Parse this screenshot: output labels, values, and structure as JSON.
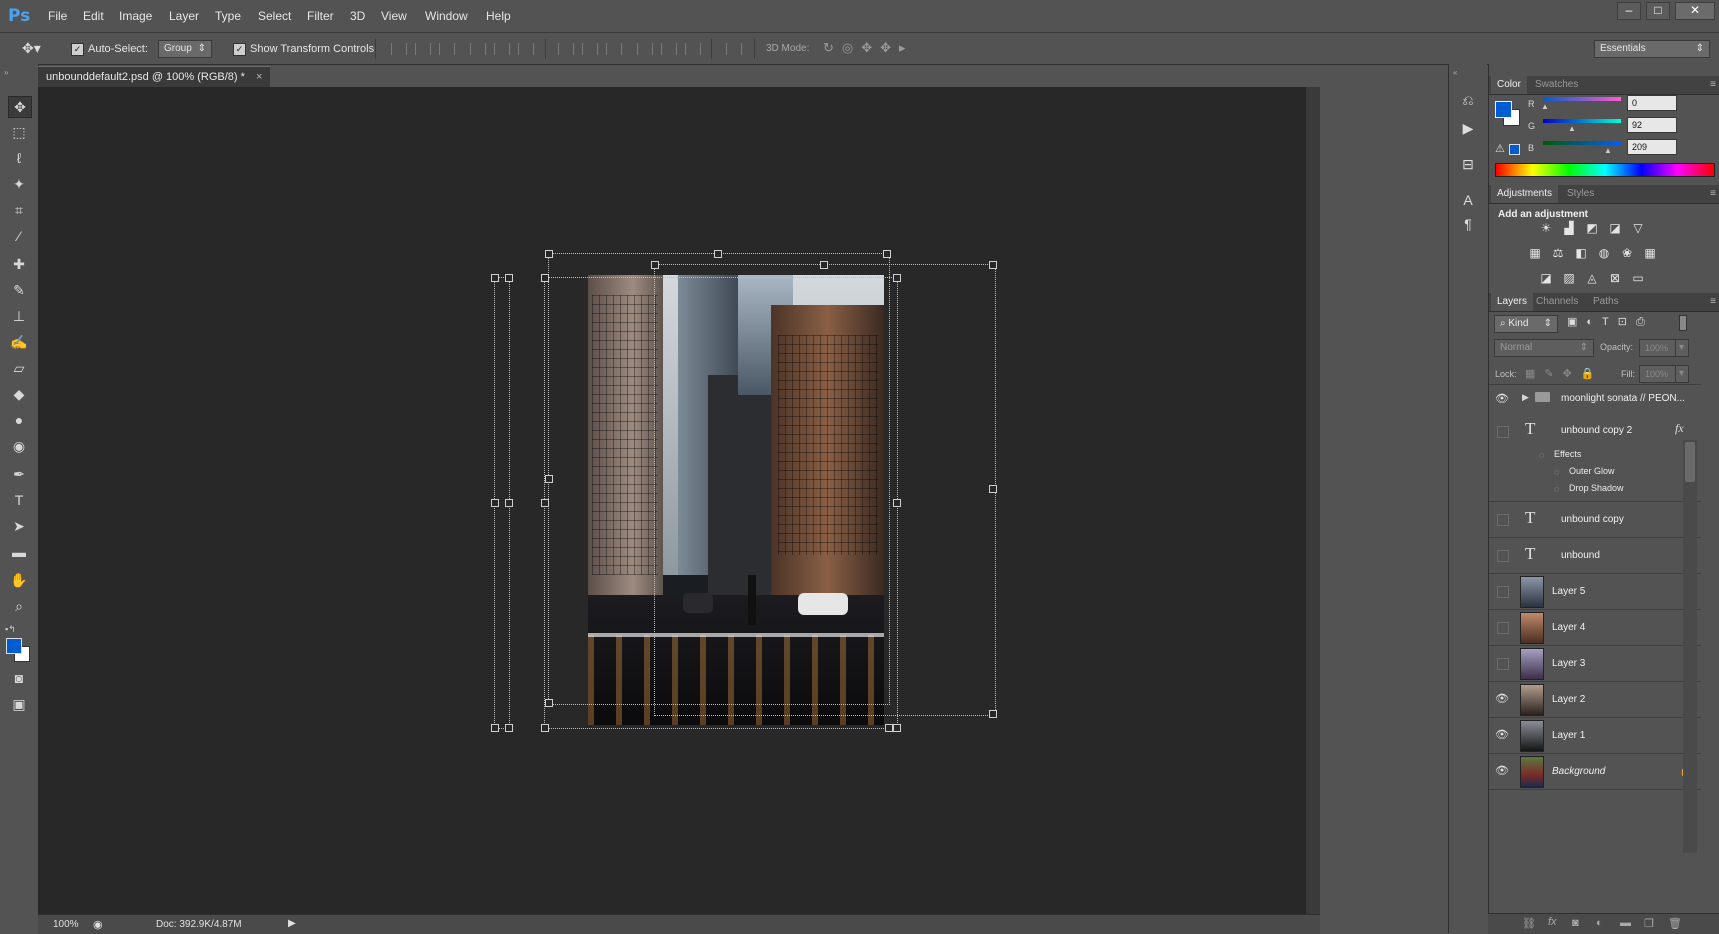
{
  "app": {
    "logo": "Ps",
    "menus": [
      "File",
      "Edit",
      "Image",
      "Layer",
      "Type",
      "Select",
      "Filter",
      "3D",
      "View",
      "Window",
      "Help"
    ],
    "window_buttons": [
      "–",
      "□",
      "✕"
    ]
  },
  "options_bar": {
    "auto_select_label": "Auto-Select:",
    "auto_select_checked": true,
    "group_value": "Group",
    "show_transform_label": "Show Transform Controls",
    "show_transform_checked": true,
    "mode_3d_label": "3D Mode:",
    "workspace_value": "Essentials"
  },
  "document": {
    "tab_title": "unbounddefault2.psd @ 100% (RGB/8) *",
    "tab_close": "×"
  },
  "status_bar": {
    "zoom": "100%",
    "doc_info": "Doc: 392.9K/4.87M"
  },
  "color_panel": {
    "tabs": [
      "Color",
      "Swatches"
    ],
    "active_tab": "Color",
    "r_label": "R",
    "r_value": "0",
    "g_label": "G",
    "g_value": "92",
    "b_label": "B",
    "b_value": "209",
    "foreground": "#005cd1",
    "background": "#ffffff"
  },
  "adjustments_panel": {
    "tabs": [
      "Adjustments",
      "Styles"
    ],
    "active_tab": "Adjustments",
    "heading": "Add an adjustment",
    "icons_row1": [
      "brightness-icon",
      "levels-icon",
      "curves-icon",
      "exposure-icon",
      "gradient-triangle-icon"
    ],
    "icons_row2": [
      "vibrance-icon",
      "balance-icon",
      "black-white-icon",
      "photo-filter-icon",
      "channel-mixer-icon",
      "color-lookup-icon"
    ],
    "icons_row3": [
      "invert-icon",
      "posterize-icon",
      "threshold-icon",
      "selective-color-icon",
      "gradient-map-icon"
    ]
  },
  "layers_panel": {
    "tabs": [
      "Layers",
      "Channels",
      "Paths"
    ],
    "active_tab": "Layers",
    "filter_kind": "Kind",
    "blend_mode": "Normal",
    "opacity_label": "Opacity:",
    "opacity_value": "100%",
    "lock_label": "Lock:",
    "fill_label": "Fill:",
    "fill_value": "100%",
    "layers": [
      {
        "name": "moonlight sonata // PEON...",
        "type": "group",
        "visible": true
      },
      {
        "name": "unbound copy 2",
        "type": "text",
        "visible": false,
        "fx": "fx"
      },
      {
        "name": "unbound copy",
        "type": "text",
        "visible": false
      },
      {
        "name": "unbound",
        "type": "text",
        "visible": false
      },
      {
        "name": "Layer 5",
        "type": "image",
        "visible": false
      },
      {
        "name": "Layer 4",
        "type": "image",
        "visible": false
      },
      {
        "name": "Layer 3",
        "type": "image",
        "visible": false
      },
      {
        "name": "Layer 2",
        "type": "image",
        "visible": true
      },
      {
        "name": "Layer 1",
        "type": "image",
        "visible": true
      },
      {
        "name": "Background",
        "type": "image",
        "visible": true,
        "locked": true
      }
    ],
    "effects_label": "Effects",
    "effects": [
      "Outer Glow",
      "Drop Shadow"
    ]
  }
}
